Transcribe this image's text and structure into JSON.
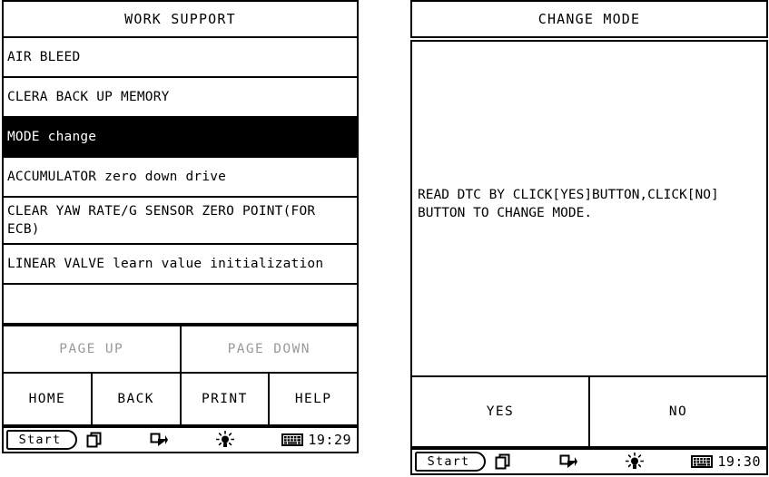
{
  "colors": {
    "ink": "#000000",
    "paper": "#ffffff",
    "disabled_text": "#9a9a9a",
    "selection_bg": "#000000",
    "selection_fg": "#ffffff"
  },
  "left_panel": {
    "title": "WORK SUPPORT",
    "menu_items": [
      {
        "label": "AIR BLEED",
        "selected": false,
        "lines": 1
      },
      {
        "label": "CLERA BACK UP MEMORY",
        "selected": false,
        "lines": 1
      },
      {
        "label": "MODE change",
        "selected": true,
        "lines": 1
      },
      {
        "label": "ACCUMULATOR zero down drive",
        "selected": false,
        "lines": 1
      },
      {
        "label": "CLEAR YAW RATE/G SENSOR ZERO POINT(FOR ECB)",
        "selected": false,
        "lines": 2
      },
      {
        "label": "LINEAR VALVE learn value initialization",
        "selected": false,
        "lines": 1
      },
      {
        "label": "",
        "selected": false,
        "lines": 1
      }
    ],
    "page_buttons": [
      {
        "label": "PAGE UP",
        "disabled": true
      },
      {
        "label": "PAGE DOWN",
        "disabled": true
      }
    ],
    "soft_keys": [
      {
        "label": "HOME",
        "disabled": false
      },
      {
        "label": "BACK",
        "disabled": false
      },
      {
        "label": "PRINT",
        "disabled": false
      },
      {
        "label": "HELP",
        "disabled": false
      }
    ],
    "taskbar": {
      "start_label": "Start",
      "icons": [
        "cascading-windows-icon",
        "switch-task-icon",
        "brightness-icon",
        "keyboard-icon"
      ],
      "clock": "19:29"
    }
  },
  "right_panel": {
    "title": "CHANGE MODE",
    "message": "READ DTC BY CLICK[YES]BUTTON,CLICK[NO]\nBUTTON TO CHANGE MODE.",
    "soft_keys": [
      {
        "label": "YES",
        "disabled": false
      },
      {
        "label": "NO",
        "disabled": false
      }
    ],
    "taskbar": {
      "start_label": "Start",
      "icons": [
        "cascading-windows-icon",
        "switch-task-icon",
        "brightness-icon",
        "keyboard-icon"
      ],
      "clock": "19:30"
    }
  }
}
